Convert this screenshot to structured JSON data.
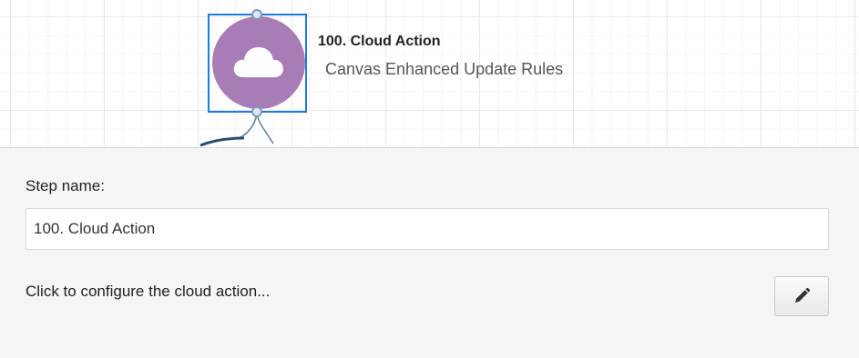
{
  "node": {
    "title": "100. Cloud Action",
    "subtitle": "Canvas Enhanced Update Rules",
    "icon": "cloud-icon",
    "color": "#a87cb6",
    "selection_color": "#1e7be0"
  },
  "panel": {
    "step_name_label": "Step name:",
    "step_name_value": "100. Cloud Action",
    "configure_text": "Click to configure the cloud action...",
    "edit_icon": "pencil-icon"
  }
}
